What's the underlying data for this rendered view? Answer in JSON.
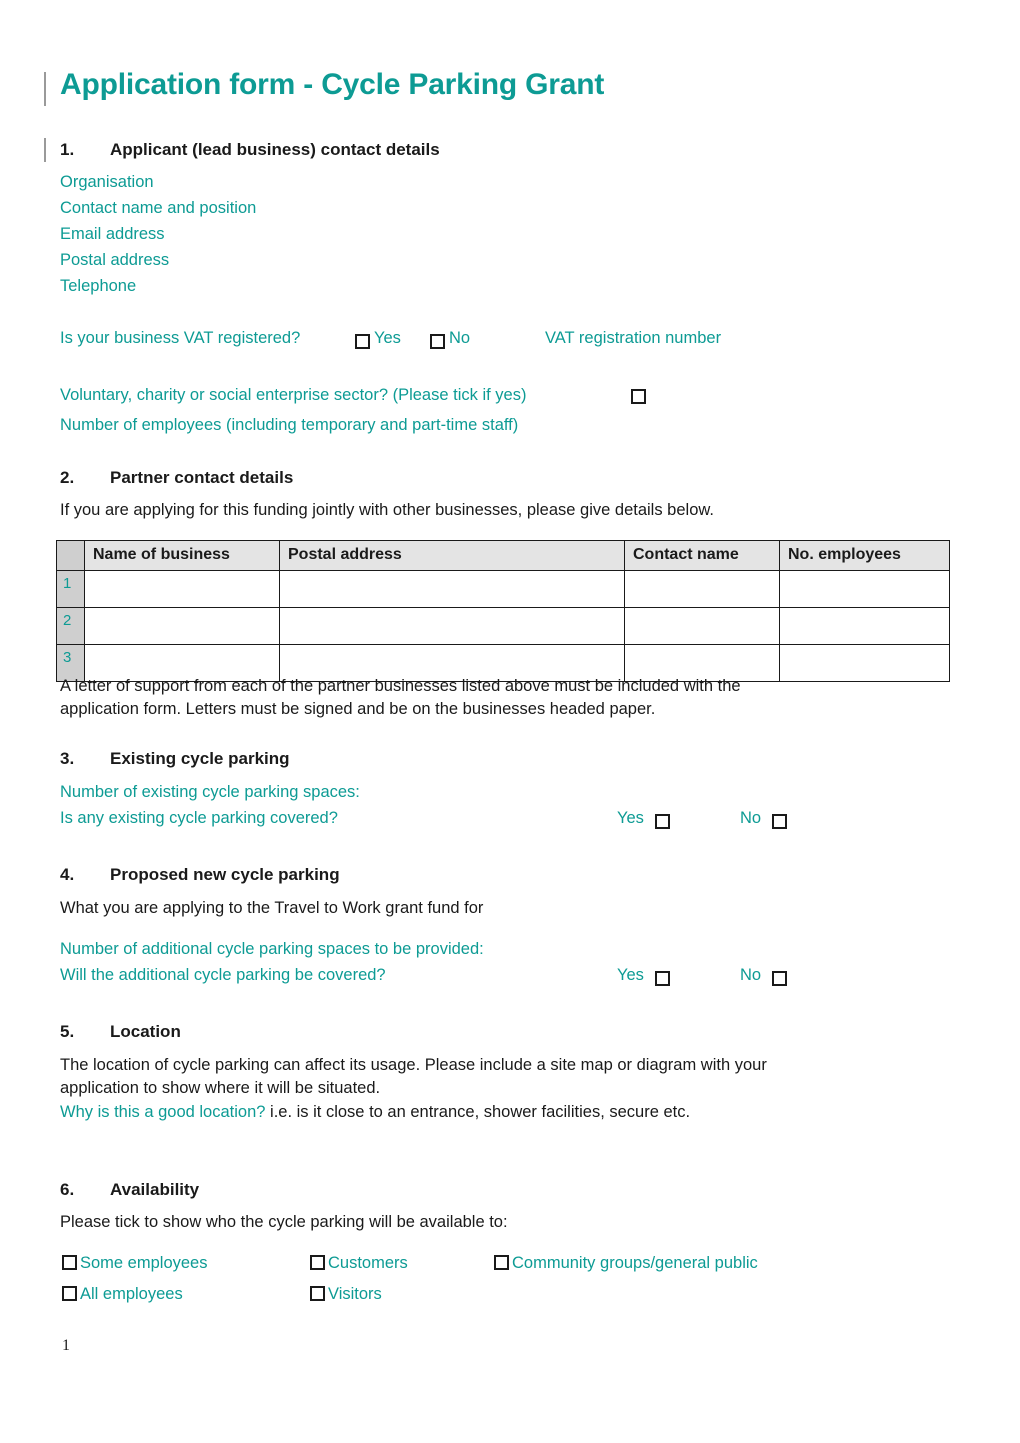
{
  "document": {
    "title": "Application form - Cycle Parking Grant",
    "page_number": "1",
    "accent_color": "#0d9b94",
    "body_color": "#1a1a1a"
  },
  "section1": {
    "number": "1.",
    "heading": "Applicant (lead business) contact details",
    "fields": [
      "Organisation",
      "Contact name and position",
      "Email address",
      "Postal address",
      "Telephone"
    ],
    "vat_question": "Is your business VAT registered?",
    "vat_yes_label": "Yes",
    "vat_no_label": "No",
    "vat_number_label": "VAT registration number",
    "voluntary_question": "Voluntary, charity or social enterprise sector? (Please tick if yes)",
    "employees_label": "Number of employees (including temporary and part-time staff)"
  },
  "section2": {
    "number": "2.",
    "heading": "Partner contact details",
    "intro": "If you are applying for this funding jointly with other businesses, please give details below.",
    "table": {
      "index_header": "",
      "headers": [
        "Name of business",
        "Postal address",
        "Contact name",
        "No. employees"
      ],
      "rows": [
        {
          "index": "1",
          "name": "",
          "address": "",
          "contact": "",
          "employees": ""
        },
        {
          "index": "2",
          "name": "",
          "address": "",
          "contact": "",
          "employees": ""
        },
        {
          "index": "3",
          "name": "",
          "address": "",
          "contact": "",
          "employees": ""
        }
      ]
    },
    "note_line1": "A letter of support from each of the partner businesses listed above must be included with the",
    "note_line2": "application form. Letters must be signed and be on the businesses headed paper."
  },
  "section3": {
    "number": "3.",
    "heading": "Existing cycle parking",
    "spaces_label": "Number of existing cycle parking spaces:",
    "covered_question": "Is any existing cycle parking covered?",
    "yes_label": "Yes",
    "no_label": "No"
  },
  "section4": {
    "number": "4.",
    "heading": "Proposed new cycle parking",
    "subtitle": "What you are applying to the Travel to Work grant fund for",
    "spaces_label": "Number of additional cycle parking spaces to be provided:",
    "covered_question": "Will the additional cycle parking be covered?",
    "yes_label": "Yes",
    "no_label": "No"
  },
  "section5": {
    "number": "5.",
    "heading": "Location",
    "body_line1": "The location of cycle parking can affect its usage. Please include a site map or diagram with your",
    "body_line2": "application to show where it will be situated.",
    "prompt_teal": "Why is this a good location?",
    "prompt_black": " i.e. is it close to an entrance, shower facilities, secure etc."
  },
  "section6": {
    "number": "6.",
    "heading": "Availability",
    "intro": "Please tick to show who the cycle parking will be available to:",
    "options": [
      "Some employees",
      "Customers",
      "Community groups/general public",
      "All employees",
      "Visitors"
    ]
  }
}
